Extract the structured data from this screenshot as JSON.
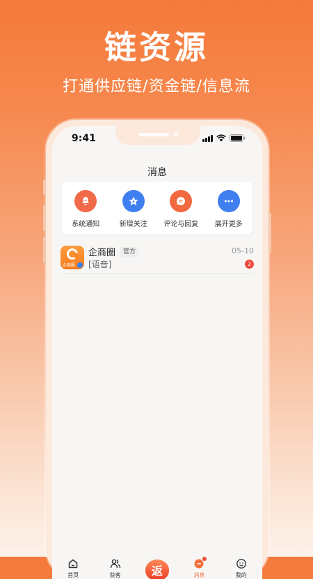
{
  "hero": {
    "title": "链资源",
    "subtitle": "打通供应链/资金链/信息流"
  },
  "status_bar": {
    "time": "9:41"
  },
  "page": {
    "title": "消息"
  },
  "quick_actions": [
    {
      "label": "系统通知",
      "icon": "bell-icon",
      "color": "#f06a4a"
    },
    {
      "label": "新增关注",
      "icon": "star-icon",
      "color": "#3f7ff0"
    },
    {
      "label": "评论与回复",
      "icon": "comment-icon",
      "color": "#f2693f"
    },
    {
      "label": "展开更多",
      "icon": "more-icon",
      "color": "#3f7ff0"
    }
  ],
  "messages": [
    {
      "name": "企商圈",
      "tag": "官方",
      "preview": "[语音]",
      "date": "05-10",
      "unread": "2",
      "avatar_text": "企商圈"
    }
  ],
  "tabbar": {
    "items": [
      {
        "label": "首页",
        "icon": "home-icon"
      },
      {
        "label": "获客",
        "icon": "users-icon"
      },
      {
        "label": "",
        "icon": "rebate-icon",
        "center_text": "返"
      },
      {
        "label": "消息",
        "icon": "message-icon",
        "active": true
      },
      {
        "label": "我的",
        "icon": "profile-icon"
      }
    ]
  },
  "colors": {
    "accent": "#f5713b",
    "badge": "#f04a3c"
  }
}
